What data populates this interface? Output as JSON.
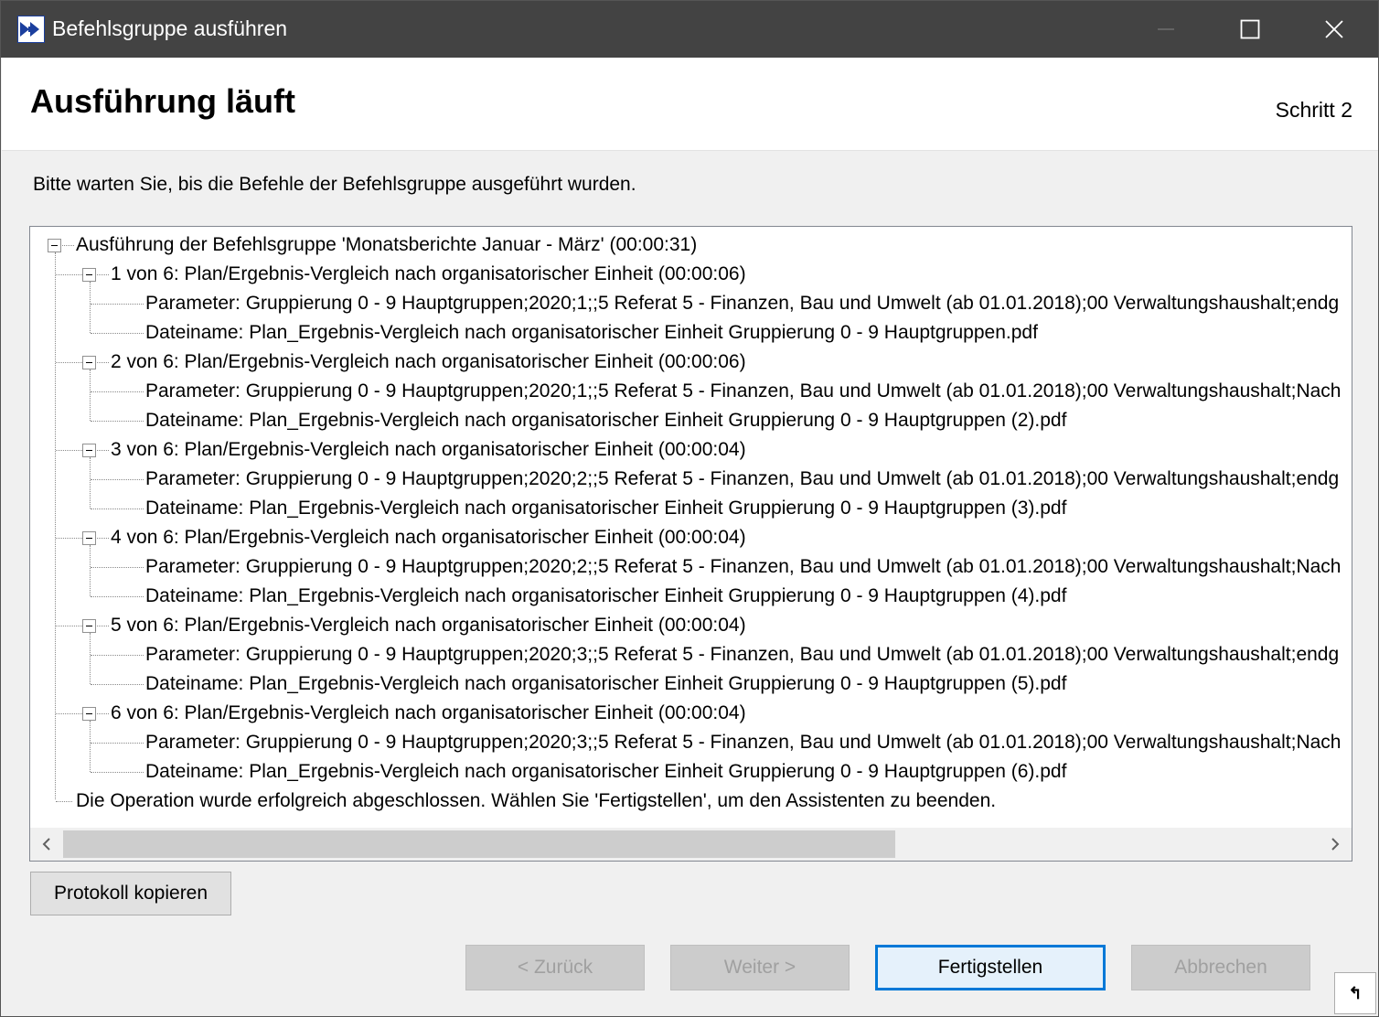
{
  "window": {
    "title": "Befehlsgruppe ausführen",
    "controls": {
      "minimize": "minimize",
      "maximize": "maximize",
      "close": "close"
    }
  },
  "header": {
    "title": "Ausführung läuft",
    "step": "Schritt 2"
  },
  "instruction": "Bitte warten Sie, bis die Befehle der Befehlsgruppe ausgeführt wurden.",
  "tree": {
    "root": "Ausführung der Befehlsgruppe 'Monatsberichte Januar - März' (00:00:31)",
    "commands": [
      {
        "label": "1 von 6: Plan/Ergebnis-Vergleich nach organisatorischer Einheit (00:00:06)",
        "parameter": "Parameter: Gruppierung 0 - 9 Hauptgruppen;2020;1;;5 Referat 5 - Finanzen, Bau und Umwelt (ab 01.01.2018);00 Verwaltungshaushalt;endg",
        "file": "Dateiname: Plan_Ergebnis-Vergleich nach organisatorischer Einheit Gruppierung 0 - 9 Hauptgruppen.pdf"
      },
      {
        "label": "2 von 6: Plan/Ergebnis-Vergleich nach organisatorischer Einheit (00:00:06)",
        "parameter": "Parameter: Gruppierung 0 - 9 Hauptgruppen;2020;1;;5 Referat 5 - Finanzen, Bau und Umwelt (ab 01.01.2018);00 Verwaltungshaushalt;Nach",
        "file": "Dateiname: Plan_Ergebnis-Vergleich nach organisatorischer Einheit Gruppierung 0 - 9 Hauptgruppen (2).pdf"
      },
      {
        "label": "3 von 6: Plan/Ergebnis-Vergleich nach organisatorischer Einheit (00:00:04)",
        "parameter": "Parameter: Gruppierung 0 - 9 Hauptgruppen;2020;2;;5 Referat 5 - Finanzen, Bau und Umwelt (ab 01.01.2018);00 Verwaltungshaushalt;endg",
        "file": "Dateiname: Plan_Ergebnis-Vergleich nach organisatorischer Einheit Gruppierung 0 - 9 Hauptgruppen (3).pdf"
      },
      {
        "label": "4 von 6: Plan/Ergebnis-Vergleich nach organisatorischer Einheit (00:00:04)",
        "parameter": "Parameter: Gruppierung 0 - 9 Hauptgruppen;2020;2;;5 Referat 5 - Finanzen, Bau und Umwelt (ab 01.01.2018);00 Verwaltungshaushalt;Nach",
        "file": "Dateiname: Plan_Ergebnis-Vergleich nach organisatorischer Einheit Gruppierung 0 - 9 Hauptgruppen (4).pdf"
      },
      {
        "label": "5 von 6: Plan/Ergebnis-Vergleich nach organisatorischer Einheit (00:00:04)",
        "parameter": "Parameter: Gruppierung 0 - 9 Hauptgruppen;2020;3;;5 Referat 5 - Finanzen, Bau und Umwelt (ab 01.01.2018);00 Verwaltungshaushalt;endg",
        "file": "Dateiname: Plan_Ergebnis-Vergleich nach organisatorischer Einheit Gruppierung 0 - 9 Hauptgruppen (5).pdf"
      },
      {
        "label": "6 von 6: Plan/Ergebnis-Vergleich nach organisatorischer Einheit (00:00:04)",
        "parameter": "Parameter: Gruppierung 0 - 9 Hauptgruppen;2020;3;;5 Referat 5 - Finanzen, Bau und Umwelt (ab 01.01.2018);00 Verwaltungshaushalt;Nach",
        "file": "Dateiname: Plan_Ergebnis-Vergleich nach organisatorischer Einheit Gruppierung 0 - 9 Hauptgruppen (6).pdf"
      }
    ],
    "completion": "Die Operation wurde erfolgreich abgeschlossen. Wählen Sie 'Fertigstellen', um den Assistenten zu beenden."
  },
  "buttons": {
    "copy_log": "Protokoll kopieren",
    "back": "< Zurück",
    "next": "Weiter >",
    "finish": "Fertigstellen",
    "cancel": "Abbrechen"
  },
  "corner_glyph": "↰",
  "icons": {
    "app": "double-arrow-right-icon",
    "scroll_left": "chevron-left-icon",
    "scroll_right": "chevron-right-icon"
  },
  "colors": {
    "titlebar": "#434343",
    "accent": "#0078d7",
    "app_icon": "#1b3f9e"
  }
}
